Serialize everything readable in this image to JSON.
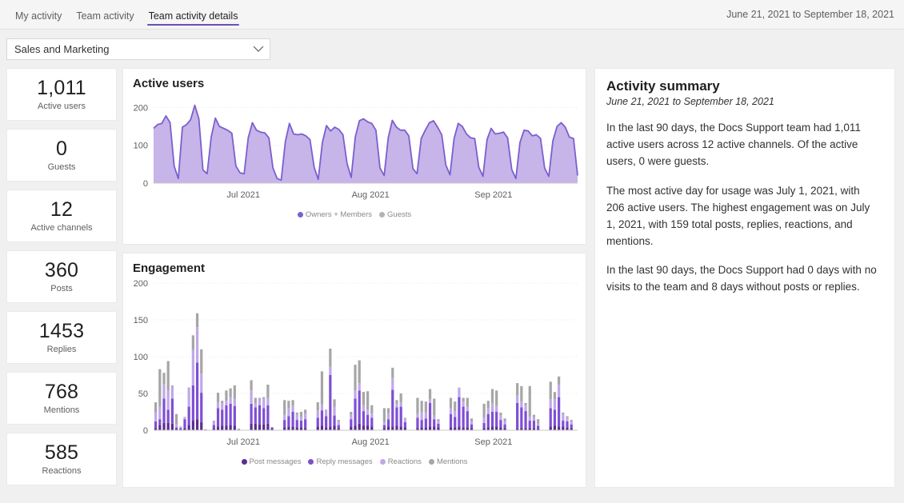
{
  "header": {
    "tabs": [
      {
        "label": "My activity",
        "active": false
      },
      {
        "label": "Team activity",
        "active": false
      },
      {
        "label": "Team activity details",
        "active": true
      }
    ],
    "date_range": "June 21, 2021 to September 18, 2021"
  },
  "team_selector": {
    "value": "Sales and Marketing",
    "chevron": "chevron-down-icon"
  },
  "kpis": [
    {
      "value": "1,011",
      "label": "Active users"
    },
    {
      "value": "0",
      "label": "Guests"
    },
    {
      "value": "12",
      "label": "Active channels"
    },
    {
      "value": "360",
      "label": "Posts"
    },
    {
      "value": "1453",
      "label": "Replies"
    },
    {
      "value": "768",
      "label": "Mentions"
    },
    {
      "value": "585",
      "label": "Reactions"
    }
  ],
  "summary": {
    "title": "Activity summary",
    "subtitle": "June 21, 2021 to September 18, 2021",
    "paragraphs": [
      "In the last 90 days, the Docs Support team had 1,011 active users across 12 active channels. Of the active users, 0 were guests.",
      "The most active day for usage was July 1, 2021, with 206 active users. The highest engagement was on July 1, 2021, with 159 total posts, replies, reactions, and mentions.",
      "In the last 90 days, the Docs Support had 0 days with no visits to the team and 8 days without posts or replies."
    ]
  },
  "colors": {
    "accent": "#6B4FBB",
    "area_stroke": "#7A5FD0",
    "area_fill": "#C7B4E8",
    "post_messages": "#5B2D90",
    "reply_messages": "#7E4FD4",
    "reactions": "#BFA8E8",
    "mentions": "#A6A6A6",
    "guests": "#B3B3B3",
    "grid": "#E6E6E6",
    "page_bg": "#F0F0F0",
    "card_bg": "#FFFFFF"
  },
  "chart_data": [
    {
      "id": "active-users",
      "type": "area",
      "title": "Active users",
      "xlabel": "",
      "ylabel": "",
      "ylim": [
        0,
        220
      ],
      "yticks": [
        0,
        100,
        200
      ],
      "ytick_labels": [
        "0",
        "100",
        "200"
      ],
      "xtick_labels": [
        "Jul 2021",
        "Aug 2021",
        "Sep 2021"
      ],
      "xtick_positions": [
        0.155,
        0.455,
        0.745
      ],
      "grid": true,
      "legend_position": "bottom",
      "legend": [
        {
          "name": "Owners + Members",
          "color": "#7A5FD0"
        },
        {
          "name": "Guests",
          "color": "#B3B3B3"
        }
      ],
      "series": [
        {
          "name": "Owners + Members",
          "color": "#7A5FD0",
          "values": [
            145,
            155,
            158,
            178,
            160,
            45,
            12,
            148,
            155,
            168,
            206,
            170,
            35,
            25,
            122,
            172,
            150,
            145,
            140,
            132,
            45,
            27,
            25,
            120,
            160,
            140,
            135,
            133,
            120,
            40,
            12,
            8,
            110,
            158,
            130,
            128,
            130,
            125,
            115,
            42,
            10,
            108,
            152,
            138,
            148,
            142,
            128,
            52,
            15,
            122,
            165,
            170,
            162,
            158,
            140,
            40,
            20,
            120,
            166,
            148,
            140,
            140,
            125,
            38,
            25,
            118,
            140,
            160,
            165,
            148,
            128,
            48,
            22,
            118,
            158,
            150,
            130,
            120,
            118,
            42,
            18,
            115,
            145,
            130,
            132,
            135,
            120,
            36,
            12,
            108,
            140,
            138,
            125,
            128,
            118,
            40,
            18,
            112,
            150,
            160,
            148,
            122,
            118,
            20
          ]
        },
        {
          "name": "Guests",
          "color": "#B3B3B3",
          "values": [
            0,
            0,
            0,
            0,
            0,
            0,
            0,
            0,
            0,
            0,
            0,
            0
          ]
        }
      ]
    },
    {
      "id": "engagement",
      "type": "bar",
      "stacked": true,
      "title": "Engagement",
      "xlabel": "",
      "ylabel": "",
      "ylim": [
        0,
        200
      ],
      "yticks": [
        0,
        50,
        100,
        150,
        200
      ],
      "ytick_labels": [
        "0",
        "50",
        "100",
        "150",
        "200"
      ],
      "xtick_labels": [
        "Jul 2021",
        "Aug 2021",
        "Sep 2021"
      ],
      "xtick_positions": [
        0.155,
        0.455,
        0.745
      ],
      "grid": true,
      "legend_position": "bottom",
      "legend": [
        {
          "name": "Post messages",
          "color": "#5B2D90"
        },
        {
          "name": "Reply messages",
          "color": "#7E4FD4"
        },
        {
          "name": "Reactions",
          "color": "#BFA8E8"
        },
        {
          "name": "Mentions",
          "color": "#A6A6A6"
        }
      ],
      "series": [
        {
          "name": "Post messages",
          "color": "#5B2D90",
          "values": [
            3,
            7,
            10,
            10,
            9,
            2,
            0,
            3,
            7,
            13,
            15,
            11,
            0,
            0,
            2,
            5,
            6,
            6,
            7,
            6,
            0,
            0,
            0,
            9,
            9,
            8,
            8,
            9,
            2,
            0,
            0,
            4,
            5,
            5,
            4,
            4,
            3,
            0,
            0,
            5,
            6,
            4,
            5,
            6,
            3,
            0,
            0,
            5,
            6,
            9,
            6,
            6,
            5,
            0,
            0,
            3,
            5,
            5,
            6,
            5,
            4,
            0,
            0,
            3,
            4,
            4,
            5,
            5,
            4,
            0,
            0,
            4,
            4,
            5,
            4,
            4,
            3,
            0,
            0,
            3,
            4,
            5,
            5,
            4,
            3,
            0,
            0,
            2,
            3,
            3,
            3,
            3,
            2,
            0,
            0,
            5,
            6,
            5,
            5,
            4,
            3,
            0
          ]
        },
        {
          "name": "Reply messages",
          "color": "#7E4FD4",
          "values": [
            9,
            8,
            33,
            18,
            34,
            2,
            3,
            12,
            25,
            48,
            77,
            40,
            1,
            0,
            5,
            25,
            22,
            28,
            29,
            27,
            1,
            0,
            0,
            27,
            22,
            26,
            22,
            25,
            2,
            0,
            0,
            10,
            14,
            20,
            10,
            9,
            12,
            0,
            0,
            12,
            21,
            15,
            70,
            14,
            4,
            0,
            0,
            10,
            37,
            45,
            20,
            15,
            12,
            0,
            0,
            4,
            10,
            50,
            25,
            27,
            7,
            0,
            0,
            14,
            10,
            12,
            32,
            10,
            5,
            0,
            0,
            18,
            14,
            40,
            28,
            22,
            5,
            0,
            0,
            7,
            18,
            20,
            20,
            10,
            5,
            0,
            0,
            35,
            28,
            23,
            10,
            10,
            4,
            0,
            0,
            25,
            22,
            40,
            8,
            8,
            5,
            0
          ]
        },
        {
          "name": "Reactions",
          "color": "#BFA8E8",
          "values": [
            12,
            17,
            20,
            26,
            17,
            4,
            1,
            2,
            25,
            48,
            48,
            26,
            0,
            0,
            5,
            8,
            9,
            6,
            9,
            10,
            0,
            0,
            0,
            18,
            5,
            9,
            13,
            10,
            0,
            0,
            0,
            7,
            11,
            8,
            7,
            5,
            7,
            0,
            0,
            10,
            8,
            8,
            11,
            12,
            5,
            0,
            0,
            6,
            11,
            10,
            8,
            7,
            6,
            0,
            0,
            4,
            8,
            16,
            5,
            6,
            5,
            0,
            0,
            5,
            11,
            8,
            5,
            5,
            4,
            0,
            0,
            8,
            8,
            13,
            7,
            6,
            4,
            0,
            0,
            7,
            8,
            12,
            8,
            6,
            4,
            0,
            0,
            10,
            8,
            8,
            6,
            5,
            3,
            0,
            0,
            12,
            14,
            17,
            9,
            5,
            4,
            0
          ]
        },
        {
          "name": "Mentions",
          "color": "#A6A6A6",
          "values": [
            14,
            51,
            15,
            40,
            1,
            14,
            1,
            1,
            1,
            20,
            19,
            33,
            0,
            0,
            1,
            13,
            3,
            14,
            12,
            18,
            1,
            0,
            0,
            14,
            8,
            1,
            2,
            18,
            0,
            0,
            0,
            20,
            10,
            8,
            3,
            7,
            6,
            0,
            0,
            11,
            45,
            1,
            25,
            10,
            2,
            0,
            0,
            4,
            35,
            31,
            18,
            25,
            11,
            0,
            0,
            19,
            7,
            14,
            5,
            12,
            1,
            0,
            0,
            22,
            15,
            15,
            14,
            23,
            2,
            0,
            0,
            14,
            13,
            0,
            5,
            12,
            4,
            0,
            0,
            19,
            10,
            19,
            21,
            4,
            4,
            0,
            0,
            17,
            21,
            3,
            41,
            3,
            6,
            0,
            0,
            24,
            10,
            11,
            2,
            2,
            2,
            0
          ]
        }
      ]
    }
  ]
}
